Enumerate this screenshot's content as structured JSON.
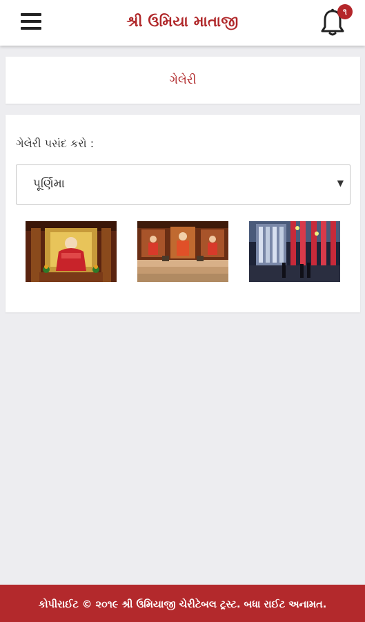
{
  "app_bar": {
    "title": "શ્રી ઉમિયા માતાજી",
    "menu_icon": "hamburger-menu-icon",
    "notification_icon": "bell-icon",
    "notification_count": "૧"
  },
  "section": {
    "title": "ગેલેરી"
  },
  "gallery_selector": {
    "label": "ગેલેરી પસંદ કરો :",
    "selected": "પૂર્ણિમા",
    "arrow_icon": "dropdown-arrow-icon"
  },
  "thumbnails": [
    {
      "subject": "goddess idol in red on golden throne"
    },
    {
      "subject": "temple altar with three idols"
    },
    {
      "subject": "illuminated temple exterior at night"
    }
  ],
  "footer": {
    "copyright": "કોપીરાઈટ © ૨૦૧૯ શ્રી ઉમિયાજી ચેરીટેબલ ટ્રસ્ટ. બધા રાઈટ અનામત."
  },
  "colors": {
    "accent": "#b0282a",
    "footer_bg": "#b3292c",
    "page_bg": "#ededf0"
  }
}
